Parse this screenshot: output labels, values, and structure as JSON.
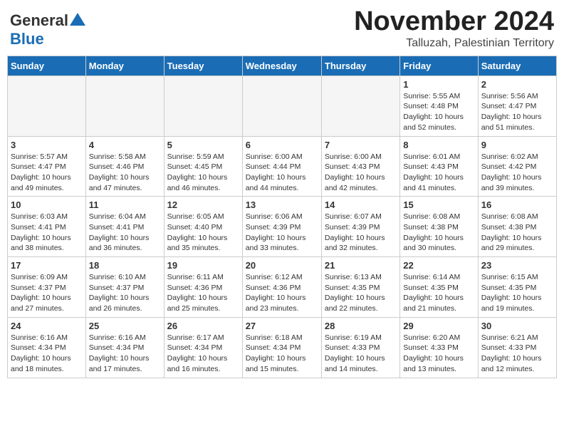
{
  "header": {
    "logo_general": "General",
    "logo_blue": "Blue",
    "month_title": "November 2024",
    "location": "Talluzah, Palestinian Territory"
  },
  "days_of_week": [
    "Sunday",
    "Monday",
    "Tuesday",
    "Wednesday",
    "Thursday",
    "Friday",
    "Saturday"
  ],
  "weeks": [
    [
      {
        "day": "",
        "info": ""
      },
      {
        "day": "",
        "info": ""
      },
      {
        "day": "",
        "info": ""
      },
      {
        "day": "",
        "info": ""
      },
      {
        "day": "",
        "info": ""
      },
      {
        "day": "1",
        "info": "Sunrise: 5:55 AM\nSunset: 4:48 PM\nDaylight: 10 hours\nand 52 minutes."
      },
      {
        "day": "2",
        "info": "Sunrise: 5:56 AM\nSunset: 4:47 PM\nDaylight: 10 hours\nand 51 minutes."
      }
    ],
    [
      {
        "day": "3",
        "info": "Sunrise: 5:57 AM\nSunset: 4:47 PM\nDaylight: 10 hours\nand 49 minutes."
      },
      {
        "day": "4",
        "info": "Sunrise: 5:58 AM\nSunset: 4:46 PM\nDaylight: 10 hours\nand 47 minutes."
      },
      {
        "day": "5",
        "info": "Sunrise: 5:59 AM\nSunset: 4:45 PM\nDaylight: 10 hours\nand 46 minutes."
      },
      {
        "day": "6",
        "info": "Sunrise: 6:00 AM\nSunset: 4:44 PM\nDaylight: 10 hours\nand 44 minutes."
      },
      {
        "day": "7",
        "info": "Sunrise: 6:00 AM\nSunset: 4:43 PM\nDaylight: 10 hours\nand 42 minutes."
      },
      {
        "day": "8",
        "info": "Sunrise: 6:01 AM\nSunset: 4:43 PM\nDaylight: 10 hours\nand 41 minutes."
      },
      {
        "day": "9",
        "info": "Sunrise: 6:02 AM\nSunset: 4:42 PM\nDaylight: 10 hours\nand 39 minutes."
      }
    ],
    [
      {
        "day": "10",
        "info": "Sunrise: 6:03 AM\nSunset: 4:41 PM\nDaylight: 10 hours\nand 38 minutes."
      },
      {
        "day": "11",
        "info": "Sunrise: 6:04 AM\nSunset: 4:41 PM\nDaylight: 10 hours\nand 36 minutes."
      },
      {
        "day": "12",
        "info": "Sunrise: 6:05 AM\nSunset: 4:40 PM\nDaylight: 10 hours\nand 35 minutes."
      },
      {
        "day": "13",
        "info": "Sunrise: 6:06 AM\nSunset: 4:39 PM\nDaylight: 10 hours\nand 33 minutes."
      },
      {
        "day": "14",
        "info": "Sunrise: 6:07 AM\nSunset: 4:39 PM\nDaylight: 10 hours\nand 32 minutes."
      },
      {
        "day": "15",
        "info": "Sunrise: 6:08 AM\nSunset: 4:38 PM\nDaylight: 10 hours\nand 30 minutes."
      },
      {
        "day": "16",
        "info": "Sunrise: 6:08 AM\nSunset: 4:38 PM\nDaylight: 10 hours\nand 29 minutes."
      }
    ],
    [
      {
        "day": "17",
        "info": "Sunrise: 6:09 AM\nSunset: 4:37 PM\nDaylight: 10 hours\nand 27 minutes."
      },
      {
        "day": "18",
        "info": "Sunrise: 6:10 AM\nSunset: 4:37 PM\nDaylight: 10 hours\nand 26 minutes."
      },
      {
        "day": "19",
        "info": "Sunrise: 6:11 AM\nSunset: 4:36 PM\nDaylight: 10 hours\nand 25 minutes."
      },
      {
        "day": "20",
        "info": "Sunrise: 6:12 AM\nSunset: 4:36 PM\nDaylight: 10 hours\nand 23 minutes."
      },
      {
        "day": "21",
        "info": "Sunrise: 6:13 AM\nSunset: 4:35 PM\nDaylight: 10 hours\nand 22 minutes."
      },
      {
        "day": "22",
        "info": "Sunrise: 6:14 AM\nSunset: 4:35 PM\nDaylight: 10 hours\nand 21 minutes."
      },
      {
        "day": "23",
        "info": "Sunrise: 6:15 AM\nSunset: 4:35 PM\nDaylight: 10 hours\nand 19 minutes."
      }
    ],
    [
      {
        "day": "24",
        "info": "Sunrise: 6:16 AM\nSunset: 4:34 PM\nDaylight: 10 hours\nand 18 minutes."
      },
      {
        "day": "25",
        "info": "Sunrise: 6:16 AM\nSunset: 4:34 PM\nDaylight: 10 hours\nand 17 minutes."
      },
      {
        "day": "26",
        "info": "Sunrise: 6:17 AM\nSunset: 4:34 PM\nDaylight: 10 hours\nand 16 minutes."
      },
      {
        "day": "27",
        "info": "Sunrise: 6:18 AM\nSunset: 4:34 PM\nDaylight: 10 hours\nand 15 minutes."
      },
      {
        "day": "28",
        "info": "Sunrise: 6:19 AM\nSunset: 4:33 PM\nDaylight: 10 hours\nand 14 minutes."
      },
      {
        "day": "29",
        "info": "Sunrise: 6:20 AM\nSunset: 4:33 PM\nDaylight: 10 hours\nand 13 minutes."
      },
      {
        "day": "30",
        "info": "Sunrise: 6:21 AM\nSunset: 4:33 PM\nDaylight: 10 hours\nand 12 minutes."
      }
    ]
  ]
}
